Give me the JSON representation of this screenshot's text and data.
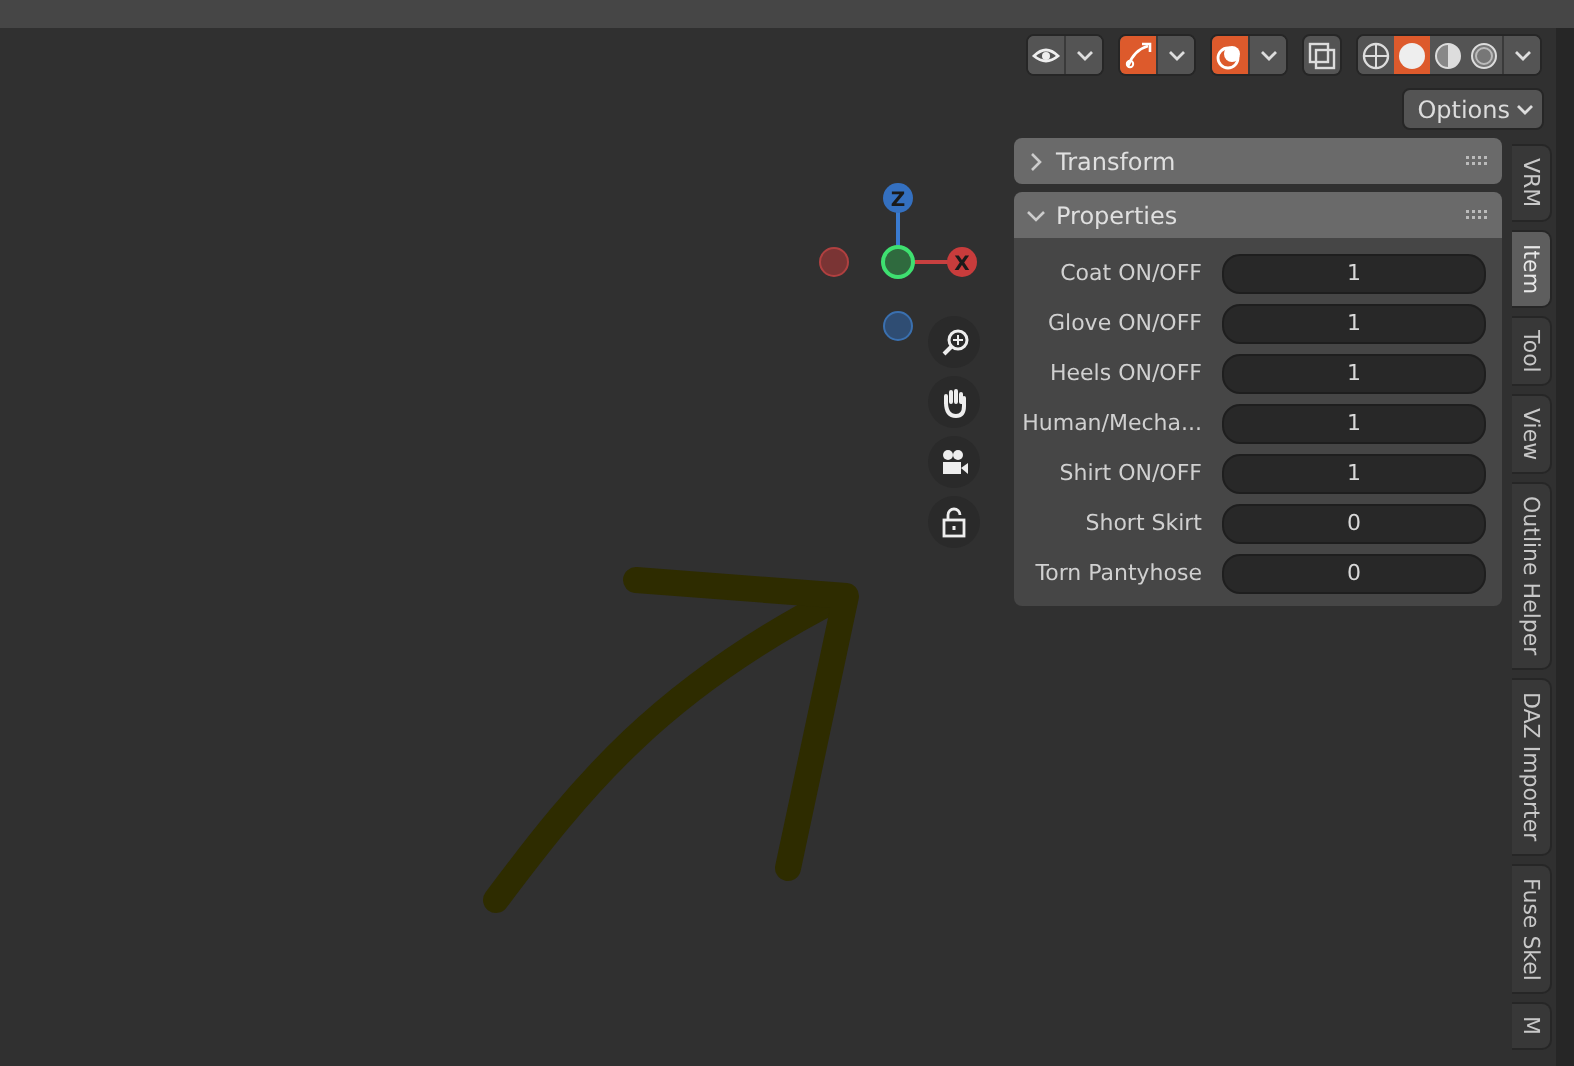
{
  "header_tools": [
    {
      "kind": "visibility",
      "on": false
    },
    {
      "kind": "gizmos",
      "on": true
    },
    {
      "kind": "overlays",
      "on": true
    },
    {
      "kind": "xray",
      "on": false
    }
  ],
  "shading_modes": [
    {
      "kind": "wireframe",
      "selected": false
    },
    {
      "kind": "solid",
      "selected": true
    },
    {
      "kind": "material",
      "selected": false
    },
    {
      "kind": "rendered",
      "selected": false
    }
  ],
  "options_button": "Options",
  "gizmo": {
    "z_label": "Z",
    "x_label": "X"
  },
  "nav_buttons": [
    {
      "kind": "zoom"
    },
    {
      "kind": "pan"
    },
    {
      "kind": "camera"
    },
    {
      "kind": "lock"
    }
  ],
  "panels": [
    {
      "title": "Transform",
      "expanded": false
    },
    {
      "title": "Properties",
      "expanded": true,
      "properties": [
        {
          "label": "Coat ON/OFF",
          "value": "1"
        },
        {
          "label": "Glove ON/OFF",
          "value": "1"
        },
        {
          "label": "Heels ON/OFF",
          "value": "1"
        },
        {
          "label": "Human/Mecha...",
          "value": "1"
        },
        {
          "label": "Shirt ON/OFF",
          "value": "1"
        },
        {
          "label": "Short Skirt",
          "value": "0"
        },
        {
          "label": "Torn Pantyhose",
          "value": "0"
        }
      ]
    }
  ],
  "sidebar_tabs": [
    {
      "label": "VRM",
      "selected": false
    },
    {
      "label": "Item",
      "selected": true
    },
    {
      "label": "Tool",
      "selected": false
    },
    {
      "label": "View",
      "selected": false
    },
    {
      "label": "Outline Helper",
      "selected": false
    },
    {
      "label": "DAZ Importer",
      "selected": false
    },
    {
      "label": "Fuse Skel",
      "selected": false
    },
    {
      "label": "M",
      "selected": false
    }
  ]
}
